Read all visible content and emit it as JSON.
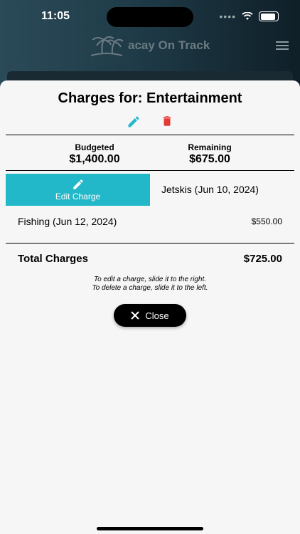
{
  "status": {
    "time": "11:05"
  },
  "app": {
    "logo_text": "acay On Track"
  },
  "sheet": {
    "title": "Charges for: Entertainment",
    "budgeted_label": "Budgeted",
    "budgeted_value": "$1,400.00",
    "remaining_label": "Remaining",
    "remaining_value": "$675.00",
    "edit_action_label": "Edit Charge",
    "charges": [
      {
        "name": "Jetskis (Jun 10, 2024)",
        "amount": ""
      },
      {
        "name": "Fishing (Jun 12, 2024)",
        "amount": "$550.00"
      }
    ],
    "total_label": "Total Charges",
    "total_value": "$725.00",
    "hint_edit": "To edit a charge, slide it to the right.",
    "hint_delete": "To delete a charge, slide it to the left.",
    "close_label": "Close"
  },
  "colors": {
    "accent": "#22b7c9",
    "delete": "#e53935",
    "header_dark": "#1f3b48"
  },
  "icons": {
    "edit": "pencil-icon",
    "delete": "trash-icon",
    "close": "x-icon",
    "menu": "hamburger-icon",
    "wifi": "wifi-icon",
    "battery": "battery-icon",
    "logo": "palm-tree-icon"
  }
}
